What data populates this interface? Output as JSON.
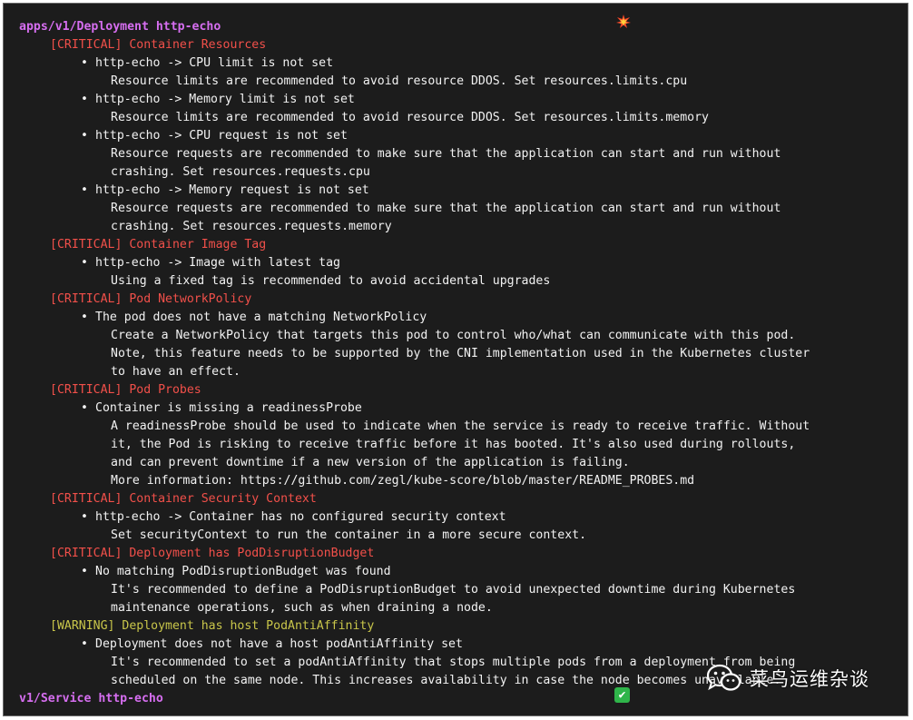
{
  "colors": {
    "background": "#1c1c1c",
    "object": "#d66ef0",
    "critical": "#f2504a",
    "warning": "#c9c64a",
    "text": "#f2f2f2"
  },
  "badges": {
    "deployment_icon": "explosion-emoji",
    "service_icon": "check-mark-button-emoji",
    "service_check": "✔"
  },
  "lines": [
    {
      "kind": "obj",
      "text": "apps/v1/Deployment http-echo"
    },
    {
      "kind": "critical",
      "text": "[CRITICAL] Container Resources"
    },
    {
      "kind": "item",
      "text": "http-echo -> CPU limit is not set"
    },
    {
      "kind": "detail",
      "text": "Resource limits are recommended to avoid resource DDOS. Set resources.limits.cpu"
    },
    {
      "kind": "item",
      "text": "http-echo -> Memory limit is not set"
    },
    {
      "kind": "detail",
      "text": "Resource limits are recommended to avoid resource DDOS. Set resources.limits.memory"
    },
    {
      "kind": "item",
      "text": "http-echo -> CPU request is not set"
    },
    {
      "kind": "detail",
      "text": "Resource requests are recommended to make sure that the application can start and run without"
    },
    {
      "kind": "detail",
      "text": "crashing. Set resources.requests.cpu"
    },
    {
      "kind": "item",
      "text": "http-echo -> Memory request is not set"
    },
    {
      "kind": "detail",
      "text": "Resource requests are recommended to make sure that the application can start and run without"
    },
    {
      "kind": "detail",
      "text": "crashing. Set resources.requests.memory"
    },
    {
      "kind": "critical",
      "text": "[CRITICAL] Container Image Tag"
    },
    {
      "kind": "item",
      "text": "http-echo -> Image with latest tag"
    },
    {
      "kind": "detail",
      "text": "Using a fixed tag is recommended to avoid accidental upgrades"
    },
    {
      "kind": "critical",
      "text": "[CRITICAL] Pod NetworkPolicy"
    },
    {
      "kind": "item",
      "text": "The pod does not have a matching NetworkPolicy"
    },
    {
      "kind": "detail",
      "text": "Create a NetworkPolicy that targets this pod to control who/what can communicate with this pod."
    },
    {
      "kind": "detail",
      "text": "Note, this feature needs to be supported by the CNI implementation used in the Kubernetes cluster"
    },
    {
      "kind": "detail",
      "text": "to have an effect."
    },
    {
      "kind": "critical",
      "text": "[CRITICAL] Pod Probes"
    },
    {
      "kind": "item",
      "text": "Container is missing a readinessProbe"
    },
    {
      "kind": "detail",
      "text": "A readinessProbe should be used to indicate when the service is ready to receive traffic. Without"
    },
    {
      "kind": "detail",
      "text": "it, the Pod is risking to receive traffic before it has booted. It's also used during rollouts,"
    },
    {
      "kind": "detail",
      "text": "and can prevent downtime if a new version of the application is failing."
    },
    {
      "kind": "detail",
      "text": "More information: https://github.com/zegl/kube-score/blob/master/README_PROBES.md"
    },
    {
      "kind": "critical",
      "text": "[CRITICAL] Container Security Context"
    },
    {
      "kind": "item",
      "text": "http-echo -> Container has no configured security context"
    },
    {
      "kind": "detail",
      "text": "Set securityContext to run the container in a more secure context."
    },
    {
      "kind": "critical",
      "text": "[CRITICAL] Deployment has PodDisruptionBudget"
    },
    {
      "kind": "item",
      "text": "No matching PodDisruptionBudget was found"
    },
    {
      "kind": "detail",
      "text": "It's recommended to define a PodDisruptionBudget to avoid unexpected downtime during Kubernetes"
    },
    {
      "kind": "detail",
      "text": "maintenance operations, such as when draining a node."
    },
    {
      "kind": "warning",
      "text": "[WARNING] Deployment has host PodAntiAffinity"
    },
    {
      "kind": "item",
      "text": "Deployment does not have a host podAntiAffinity set"
    },
    {
      "kind": "detail",
      "text": "It's recommended to set a podAntiAffinity that stops multiple pods from a deployment from being"
    },
    {
      "kind": "detail",
      "text": "scheduled on the same node. This increases availability in case the node becomes unavailable."
    },
    {
      "kind": "obj",
      "text": "v1/Service http-echo"
    }
  ],
  "bullet_char": "•",
  "watermark": {
    "icon": "wechat-icon",
    "text": "菜鸟运维杂谈"
  }
}
